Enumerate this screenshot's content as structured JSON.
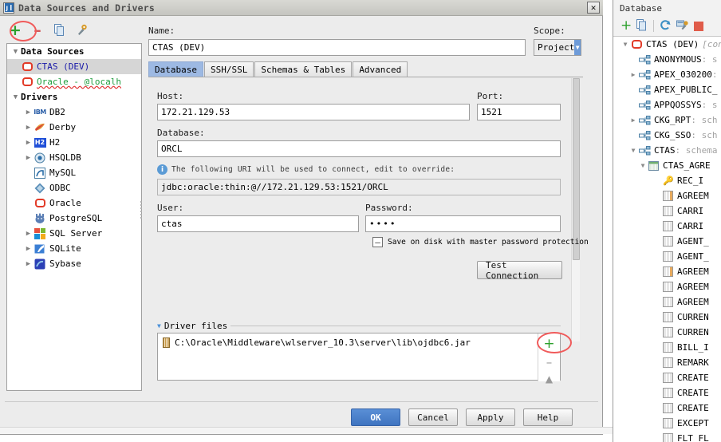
{
  "dialog": {
    "title": "Data Sources and Drivers",
    "window_icon": "jetbrains-icon",
    "close_label": "✕",
    "toolbar": [
      {
        "name": "add-data-source-button",
        "glyph": "+",
        "kind": "plus"
      },
      {
        "name": "remove-data-source-button",
        "glyph": "–",
        "kind": "minus"
      },
      {
        "name": "copy-data-source-button",
        "glyph": "copy-icon",
        "kind": "copy"
      },
      {
        "name": "properties-button",
        "glyph": "wrench-icon",
        "kind": "wrench"
      }
    ],
    "tree": {
      "groups": [
        {
          "label": "Data Sources",
          "expanded": true,
          "items": [
            {
              "label": "CTAS (DEV)",
              "icon": "oracle-icon",
              "style": "blue",
              "selected": true,
              "expandable": false
            },
            {
              "label": "Oracle - @localh",
              "icon": "oracle-icon",
              "style": "green-underlined",
              "selected": false,
              "expandable": false
            }
          ]
        },
        {
          "label": "Drivers",
          "expanded": true,
          "items": [
            {
              "label": "DB2",
              "icon": "db2-icon",
              "style": "plain",
              "expandable": true
            },
            {
              "label": "Derby",
              "icon": "derby-icon",
              "style": "plain",
              "expandable": true
            },
            {
              "label": "H2",
              "icon": "h2-icon",
              "style": "plain",
              "expandable": true
            },
            {
              "label": "HSQLDB",
              "icon": "hsqldb-icon",
              "style": "plain",
              "expandable": true
            },
            {
              "label": "MySQL",
              "icon": "mysql-icon",
              "style": "plain",
              "expandable": false
            },
            {
              "label": "ODBC",
              "icon": "odbc-icon",
              "style": "plain",
              "expandable": false
            },
            {
              "label": "Oracle",
              "icon": "oracle-icon",
              "style": "plain",
              "expandable": false
            },
            {
              "label": "PostgreSQL",
              "icon": "postgresql-icon",
              "style": "plain",
              "expandable": false
            },
            {
              "label": "SQL Server",
              "icon": "sqlserver-icon",
              "style": "plain",
              "expandable": true
            },
            {
              "label": "SQLite",
              "icon": "sqlite-icon",
              "style": "plain",
              "expandable": true
            },
            {
              "label": "Sybase",
              "icon": "sybase-icon",
              "style": "plain",
              "expandable": true
            }
          ]
        }
      ]
    },
    "form": {
      "name_label": "Name:",
      "name_value": "CTAS (DEV)",
      "scope_label": "Scope:",
      "scope_value": "Project",
      "tabs": [
        {
          "label": "Database",
          "active": true
        },
        {
          "label": "SSH/SSL",
          "active": false
        },
        {
          "label": "Schemas & Tables",
          "active": false
        },
        {
          "label": "Advanced",
          "active": false
        }
      ],
      "host_label": "Host:",
      "host_value": "172.21.129.53",
      "port_label": "Port:",
      "port_value": "1521",
      "database_label": "Database:",
      "database_value": "ORCL",
      "uri_hint": "The following URI will be used to connect, edit to override:",
      "uri_value": "jdbc:oracle:thin:@//172.21.129.53:1521/ORCL",
      "user_label": "User:",
      "user_value": "ctas",
      "password_label": "Password:",
      "password_value": "••••",
      "save_checkbox_label": "Save on disk with master password protection",
      "save_checkbox_state": "mixed",
      "test_connection_label": "Test Connection",
      "driver_files_label": "Driver files",
      "driver_files": [
        "C:\\Oracle\\Middleware\\wlserver_10.3\\server\\lib\\ojdbc6.jar"
      ],
      "driver_file_add": "+",
      "driver_file_remove": "–",
      "driver_file_up": "▲"
    },
    "buttons": [
      {
        "label": "OK",
        "primary": true,
        "name": "ok-button"
      },
      {
        "label": "Cancel",
        "primary": false,
        "name": "cancel-button"
      },
      {
        "label": "Apply",
        "primary": false,
        "name": "apply-button"
      },
      {
        "label": "Help",
        "primary": false,
        "name": "help-button"
      }
    ]
  },
  "database_panel": {
    "title": "Database",
    "toolbar": [
      {
        "name": "add-button",
        "kind": "plus"
      },
      {
        "name": "copy-button",
        "kind": "copy"
      },
      {
        "name": "refresh-button",
        "kind": "refresh"
      },
      {
        "name": "data-source-properties-button",
        "kind": "wrench"
      },
      {
        "name": "stop-button",
        "kind": "stop"
      }
    ],
    "tree": [
      {
        "level": 0,
        "twisty": "expanded",
        "icon": "oracle-icon",
        "label": "CTAS (DEV)",
        "suffix": "[conne"
      },
      {
        "level": 1,
        "twisty": "none",
        "icon": "schema-icon",
        "label": "ANONYMOUS",
        "suffix": ": s"
      },
      {
        "level": 1,
        "twisty": "collapsed",
        "icon": "schema-icon",
        "label": "APEX_030200",
        "suffix": ":"
      },
      {
        "level": 1,
        "twisty": "none",
        "icon": "schema-icon",
        "label": "APEX_PUBLIC_",
        "suffix": ""
      },
      {
        "level": 1,
        "twisty": "none",
        "icon": "schema-icon",
        "label": "APPQOSSYS",
        "suffix": ": s"
      },
      {
        "level": 1,
        "twisty": "collapsed",
        "icon": "schema-icon",
        "label": "CKG_RPT",
        "suffix": ": sch"
      },
      {
        "level": 1,
        "twisty": "none",
        "icon": "schema-icon",
        "label": "CKG_SSO",
        "suffix": ": sch"
      },
      {
        "level": 1,
        "twisty": "expanded",
        "icon": "schema-icon",
        "label": "CTAS",
        "suffix": ": schema"
      },
      {
        "level": 2,
        "twisty": "expanded",
        "icon": "table-icon",
        "label": "CTAS_AGRE",
        "suffix": ""
      },
      {
        "level": 3,
        "twisty": "none",
        "icon": "key-icon",
        "label": "REC_I",
        "suffix": ""
      },
      {
        "level": 3,
        "twisty": "none",
        "icon": "column-icon-indexed",
        "label": "AGREEM",
        "suffix": ""
      },
      {
        "level": 3,
        "twisty": "none",
        "icon": "column-icon",
        "label": "CARRI",
        "suffix": ""
      },
      {
        "level": 3,
        "twisty": "none",
        "icon": "column-icon",
        "label": "CARRI",
        "suffix": ""
      },
      {
        "level": 3,
        "twisty": "none",
        "icon": "column-icon",
        "label": "AGENT_",
        "suffix": ""
      },
      {
        "level": 3,
        "twisty": "none",
        "icon": "column-icon",
        "label": "AGENT_",
        "suffix": ""
      },
      {
        "level": 3,
        "twisty": "none",
        "icon": "column-icon-indexed",
        "label": "AGREEM",
        "suffix": ""
      },
      {
        "level": 3,
        "twisty": "none",
        "icon": "column-icon",
        "label": "AGREEM",
        "suffix": ""
      },
      {
        "level": 3,
        "twisty": "none",
        "icon": "column-icon",
        "label": "AGREEM",
        "suffix": ""
      },
      {
        "level": 3,
        "twisty": "none",
        "icon": "column-icon",
        "label": "CURREN",
        "suffix": ""
      },
      {
        "level": 3,
        "twisty": "none",
        "icon": "column-icon",
        "label": "CURREN",
        "suffix": ""
      },
      {
        "level": 3,
        "twisty": "none",
        "icon": "column-icon",
        "label": "BILL_I",
        "suffix": ""
      },
      {
        "level": 3,
        "twisty": "none",
        "icon": "column-icon",
        "label": "REMARK",
        "suffix": ""
      },
      {
        "level": 3,
        "twisty": "none",
        "icon": "column-icon",
        "label": "CREATE",
        "suffix": ""
      },
      {
        "level": 3,
        "twisty": "none",
        "icon": "column-icon",
        "label": "CREATE",
        "suffix": ""
      },
      {
        "level": 3,
        "twisty": "none",
        "icon": "column-icon",
        "label": "CREATE",
        "suffix": ""
      },
      {
        "level": 3,
        "twisty": "none",
        "icon": "column-icon",
        "label": "EXCEPT",
        "suffix": ""
      },
      {
        "level": 3,
        "twisty": "none",
        "icon": "column-icon",
        "label": "FLT_FL",
        "suffix": ""
      }
    ]
  },
  "annotations": {
    "color": "#f05a5a",
    "marks": [
      "dialog-add-data-source",
      "database-panel-add",
      "driver-file-add"
    ]
  }
}
